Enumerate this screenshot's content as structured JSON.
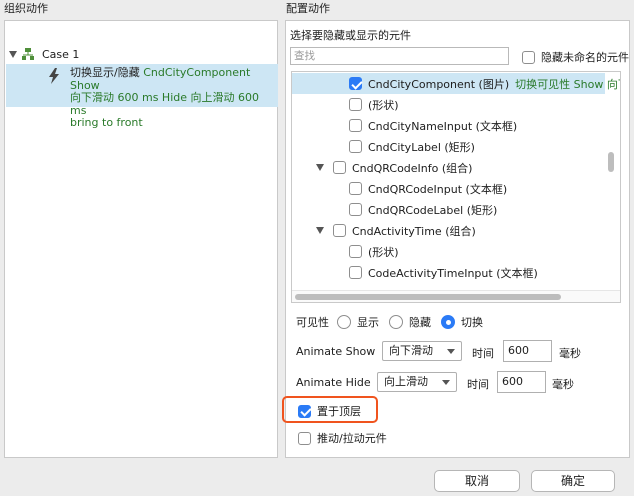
{
  "left_panel": {
    "title": "组织动作",
    "case_label": "Case 1",
    "action": {
      "prefix": "切换显示/隐藏",
      "detail_line1": "CndCityComponent Show",
      "detail_line2": "向下滑动 600 ms Hide 向上滑动 600 ms",
      "detail_line3": "bring to front"
    }
  },
  "right_panel": {
    "title": "配置动作",
    "hint": "选择要隐藏或显示的元件",
    "filter_placeholder": "查找",
    "hide_unnamed_label": "隐藏未命名的元件",
    "widgets": [
      {
        "name": "CndCityComponent (图片)",
        "status": "切换可见性 Show 向下",
        "checked": true,
        "selected": true
      },
      {
        "name": "(形状)",
        "checked": false
      },
      {
        "name": "CndCityNameInput (文本框)",
        "checked": false
      },
      {
        "name": "CndCityLabel (矩形)",
        "checked": false
      },
      {
        "name": "CndQRCodeInfo (组合)",
        "checked": false,
        "group": true
      },
      {
        "name": "CndQRCodeInput (文本框)",
        "checked": false
      },
      {
        "name": "CndQRCodeLabel (矩形)",
        "checked": false
      },
      {
        "name": "CndActivityTime (组合)",
        "checked": false,
        "group": true
      },
      {
        "name": "(形状)",
        "checked": false
      },
      {
        "name": "CodeActivityTimeInput (文本框)",
        "checked": false
      }
    ],
    "visibility": {
      "label": "可见性",
      "options": [
        "显示",
        "隐藏",
        "切换"
      ],
      "selected": "切换"
    },
    "animate_show": {
      "label": "Animate Show",
      "value": "向下滑动",
      "time_label": "时间",
      "time_value": "600",
      "unit": "毫秒"
    },
    "animate_hide": {
      "label": "Animate Hide",
      "value": "向上滑动",
      "time_label": "时间",
      "time_value": "600",
      "unit": "毫秒"
    },
    "bring_to_front": {
      "label": "置于顶层",
      "checked": true
    },
    "push_pull": {
      "label": "推动/拉动元件",
      "checked": false
    }
  },
  "footer": {
    "cancel": "取消",
    "ok": "确定"
  },
  "colors": {
    "accent": "#2b7bf6",
    "selection": "#cde6f4",
    "highlight": "#f0541e",
    "green_text": "#2a7a2a"
  }
}
